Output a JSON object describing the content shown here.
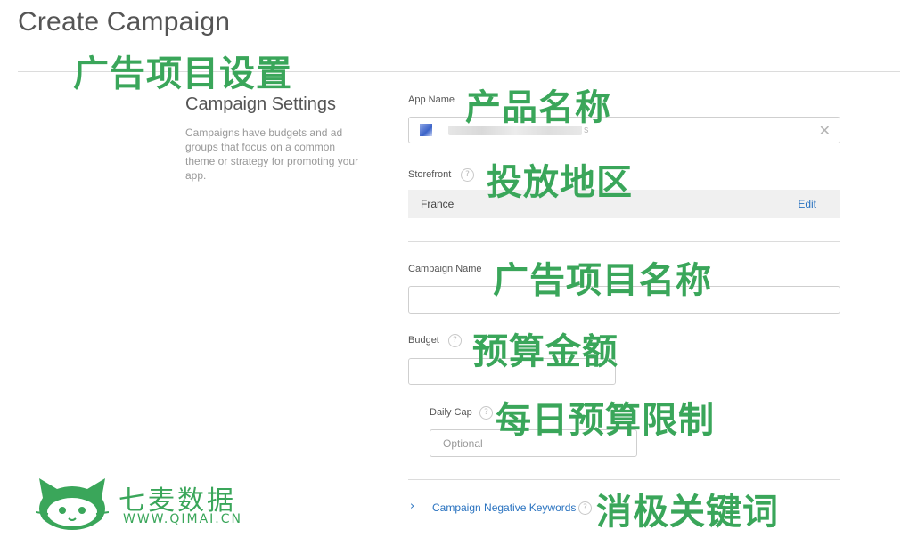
{
  "page": {
    "title": "Create Campaign"
  },
  "settings": {
    "title": "Campaign Settings",
    "description": "Campaigns have budgets and ad groups that focus on a common theme or strategy for promoting your app."
  },
  "fields": {
    "app_name_label": "App Name",
    "app_name_suffix": "s",
    "storefront_label": "Storefront",
    "storefront_value": "France",
    "storefront_edit": "Edit",
    "campaign_name_label": "Campaign Name",
    "budget_label": "Budget",
    "daily_cap_label": "Daily Cap",
    "daily_cap_placeholder": "Optional",
    "negative_keywords_label": "Campaign Negative Keywords",
    "help_glyph": "?",
    "clear_glyph": "✕",
    "chevron_glyph": "›"
  },
  "annotations": {
    "campaign_settings": "广告项目设置",
    "app_name": "产品名称",
    "storefront": "投放地区",
    "campaign_name": "广告项目名称",
    "budget": "预算金额",
    "daily_cap": "每日预算限制",
    "negative_keywords": "消极关键词"
  },
  "watermark": {
    "name_cn": "七麦数据",
    "site": "WWW.QIMAI.CN"
  },
  "colors": {
    "annotation": "#3aa65a",
    "link": "#2a73c0",
    "storefront_bg": "#f0f0f0"
  }
}
